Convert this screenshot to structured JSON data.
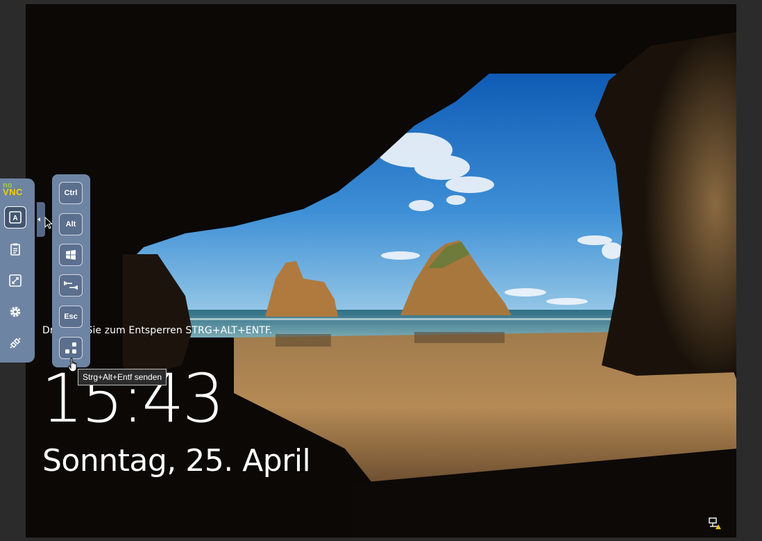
{
  "lockscreen": {
    "hint": "Drücken Sie zum Entsperren STRG+ALT+ENTF.",
    "time": "15:43",
    "date": "Sonntag, 25. April"
  },
  "novnc": {
    "logo_top": "no",
    "logo_bottom": "VNC",
    "buttons": [
      {
        "name": "keyboard-icon",
        "active": true
      },
      {
        "name": "clipboard-icon",
        "active": false
      },
      {
        "name": "fullscreen-icon",
        "active": false
      },
      {
        "name": "settings-icon",
        "active": false
      },
      {
        "name": "disconnect-icon",
        "active": false
      }
    ]
  },
  "extra_keys": {
    "ctrl": "Ctrl",
    "alt": "Alt",
    "windows": "windows-icon",
    "tab": "tab-icon",
    "esc": "Esc",
    "ctrlaltdel": "ctrl-alt-del-icon"
  },
  "tooltip": "Strg+Alt+Entf senden",
  "colors": {
    "panel": "#6e84a3",
    "panel_dark": "#44566f",
    "tooltip_bg": "#2c2c2c"
  }
}
